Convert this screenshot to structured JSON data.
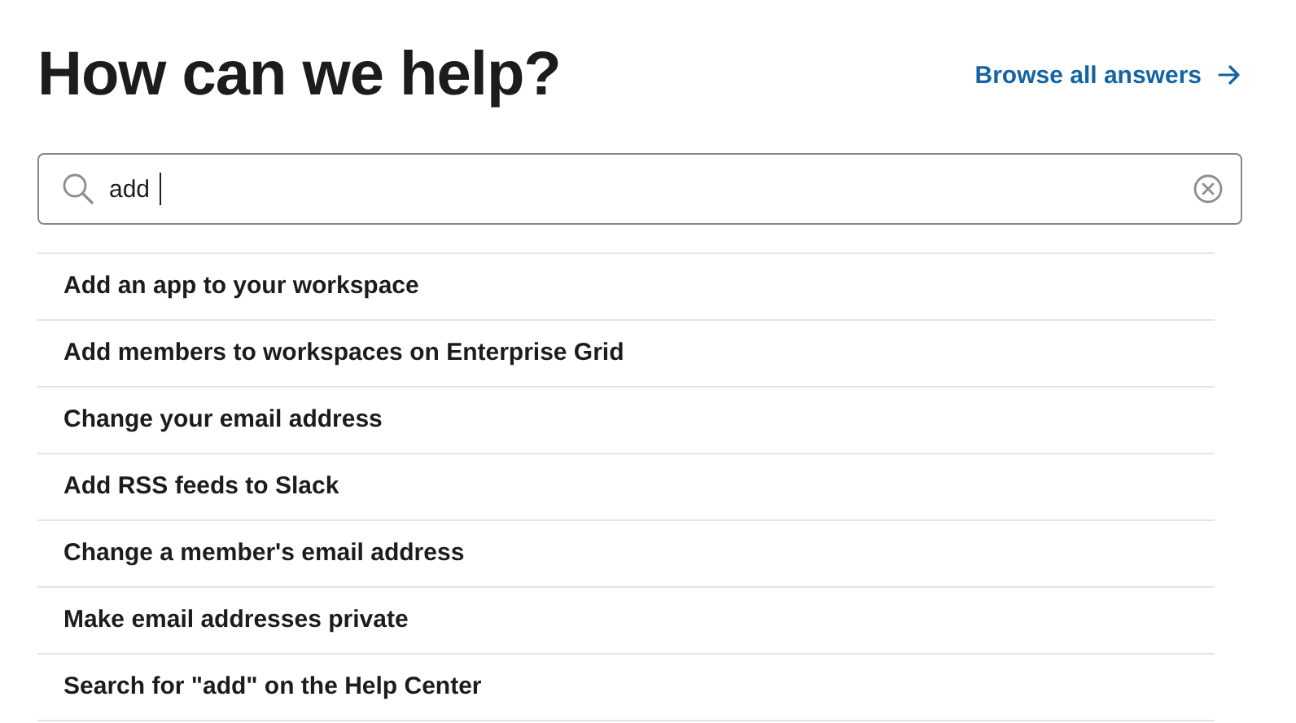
{
  "header": {
    "title": "How can we help?",
    "browse_link": "Browse all answers"
  },
  "search": {
    "value": "add"
  },
  "results": [
    {
      "label": "Add an app to your workspace"
    },
    {
      "label": "Add members to workspaces on Enterprise Grid"
    },
    {
      "label": "Change your email address"
    },
    {
      "label": "Add RSS feeds to Slack"
    },
    {
      "label": "Change a member's email address"
    },
    {
      "label": "Make email addresses private"
    },
    {
      "label": "Search for \"add\" on the Help Center"
    }
  ]
}
